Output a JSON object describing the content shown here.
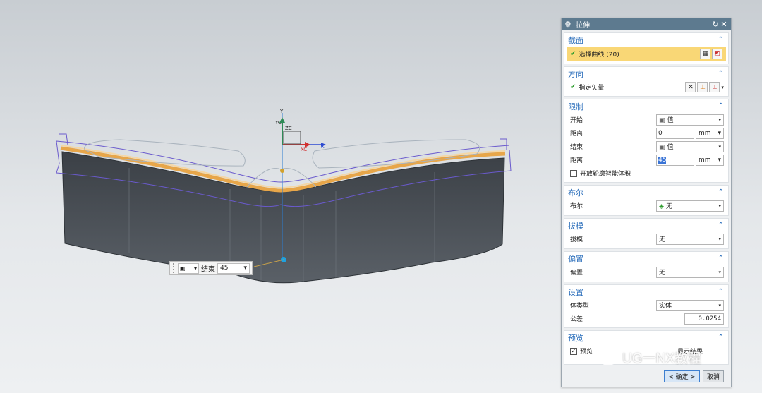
{
  "viewport": {
    "axis_labels": {
      "yc": "YC",
      "zc": "ZC",
      "xc": "XC",
      "x": "X",
      "y": "Y"
    },
    "float_input": {
      "icon": "cube-icon",
      "label": "结束",
      "value": "45"
    }
  },
  "dialog": {
    "title": "拉伸",
    "title_icon": "gear-icon",
    "section": {
      "header": "截面",
      "select_curve": "选择曲线 (20)"
    },
    "direction": {
      "header": "方向",
      "specify_vector": "指定矢量"
    },
    "limits": {
      "header": "限制",
      "start_label": "开始",
      "start_value": "值",
      "start_distance_label": "距离",
      "start_distance": "0",
      "start_unit": "mm",
      "end_label": "结束",
      "end_value": "值",
      "end_distance_label": "距离",
      "end_distance": "45",
      "end_unit": "mm",
      "open_profile": "开放轮廓智能体积"
    },
    "boolean": {
      "header": "布尔",
      "label": "布尔",
      "value": "无"
    },
    "draft": {
      "header": "拔模",
      "label": "拔模",
      "value": "无"
    },
    "offset": {
      "header": "偏置",
      "label": "偏置",
      "value": "无"
    },
    "settings": {
      "header": "设置",
      "body_type_label": "体类型",
      "body_type_value": "实体",
      "tolerance_label": "公差",
      "tolerance_value": "0.0254"
    },
    "preview": {
      "header": "预览",
      "preview_label": "预览",
      "show_result": "显示结果"
    },
    "ok_label": "< 确定 >",
    "cancel_label": "取消"
  },
  "watermark": "UG一NX教程",
  "colors": {
    "title_bar": "#5d7a8f",
    "accent": "#2a6ebb",
    "selection": "#f9d776",
    "model": "#4b5158"
  }
}
